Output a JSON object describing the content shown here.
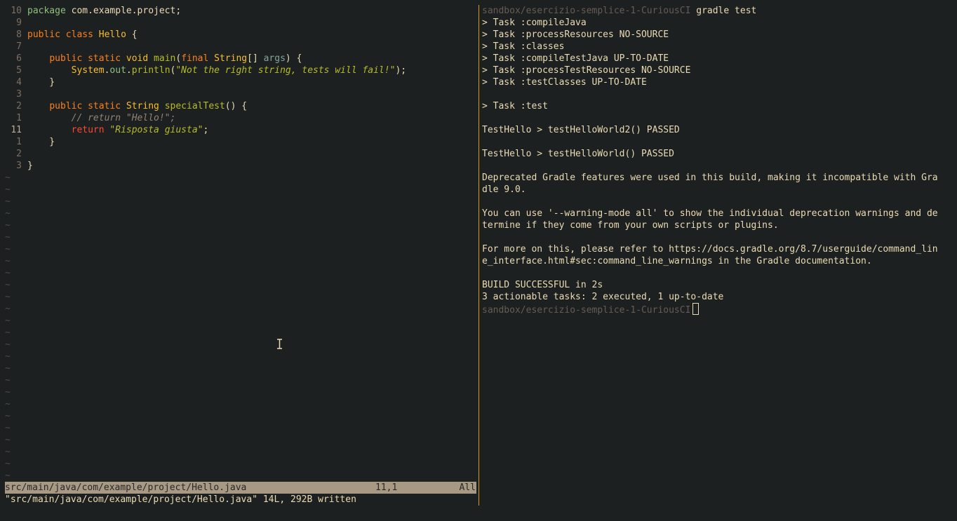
{
  "editor": {
    "lines": [
      {
        "num": "10",
        "tokens": [
          {
            "c": "pkg",
            "t": "package"
          },
          {
            "c": "plain",
            "t": " com.example.project;"
          }
        ]
      },
      {
        "num": "9",
        "tokens": []
      },
      {
        "num": "8",
        "tokens": [
          {
            "c": "kw",
            "t": "public"
          },
          {
            "c": "plain",
            "t": " "
          },
          {
            "c": "kw",
            "t": "class"
          },
          {
            "c": "plain",
            "t": " "
          },
          {
            "c": "cls",
            "t": "Hello"
          },
          {
            "c": "plain",
            "t": " {"
          }
        ]
      },
      {
        "num": "7",
        "tokens": []
      },
      {
        "num": "6",
        "tokens": [
          {
            "c": "plain",
            "t": "    "
          },
          {
            "c": "kw",
            "t": "public"
          },
          {
            "c": "plain",
            "t": " "
          },
          {
            "c": "kw",
            "t": "static"
          },
          {
            "c": "plain",
            "t": " "
          },
          {
            "c": "type",
            "t": "void"
          },
          {
            "c": "plain",
            "t": " "
          },
          {
            "c": "fn",
            "t": "main"
          },
          {
            "c": "plain",
            "t": "("
          },
          {
            "c": "kw",
            "t": "final"
          },
          {
            "c": "plain",
            "t": " "
          },
          {
            "c": "type",
            "t": "String"
          },
          {
            "c": "plain",
            "t": "[] "
          },
          {
            "c": "param",
            "t": "args"
          },
          {
            "c": "plain",
            "t": ") {"
          }
        ]
      },
      {
        "num": "5",
        "tokens": [
          {
            "c": "plain",
            "t": "        "
          },
          {
            "c": "type",
            "t": "System"
          },
          {
            "c": "plain",
            "t": "."
          },
          {
            "c": "member",
            "t": "out"
          },
          {
            "c": "plain",
            "t": "."
          },
          {
            "c": "fn",
            "t": "println"
          },
          {
            "c": "plain",
            "t": "("
          },
          {
            "c": "str",
            "t": "\"Not the right string, tests will fail!\""
          },
          {
            "c": "plain",
            "t": ");"
          }
        ]
      },
      {
        "num": "4",
        "tokens": [
          {
            "c": "plain",
            "t": "    }"
          }
        ]
      },
      {
        "num": "3",
        "tokens": []
      },
      {
        "num": "2",
        "tokens": [
          {
            "c": "plain",
            "t": "    "
          },
          {
            "c": "kw",
            "t": "public"
          },
          {
            "c": "plain",
            "t": " "
          },
          {
            "c": "kw",
            "t": "static"
          },
          {
            "c": "plain",
            "t": " "
          },
          {
            "c": "type",
            "t": "String"
          },
          {
            "c": "plain",
            "t": " "
          },
          {
            "c": "fn",
            "t": "specialTest"
          },
          {
            "c": "plain",
            "t": "() {"
          }
        ]
      },
      {
        "num": "1",
        "tokens": [
          {
            "c": "plain",
            "t": "        "
          },
          {
            "c": "cmt",
            "t": "// return \"Hello!\";"
          }
        ]
      },
      {
        "num": "11",
        "current": true,
        "tokens": [
          {
            "c": "plain",
            "t": "        "
          },
          {
            "c": "kw-red",
            "t": "return"
          },
          {
            "c": "plain",
            "t": " "
          },
          {
            "c": "str",
            "t": "\"Risposta giusta\""
          },
          {
            "c": "plain",
            "t": ";"
          }
        ]
      },
      {
        "num": "1",
        "tokens": [
          {
            "c": "plain",
            "t": "    }"
          }
        ]
      },
      {
        "num": "2",
        "tokens": []
      },
      {
        "num": "3",
        "tokens": [
          {
            "c": "plain",
            "t": "}"
          }
        ]
      }
    ],
    "tilde_count": 26,
    "tilde_char": "~"
  },
  "statusline": {
    "filename": "src/main/java/com/example/project/Hello.java",
    "position": "11,1",
    "scroll": "All"
  },
  "cmdline": {
    "message": "\"src/main/java/com/example/project/Hello.java\" 14L, 292B written"
  },
  "terminal": {
    "prompt_path": "sandbox/esercizio-semplice-1-CuriousCI",
    "command": "gradle test",
    "output": [
      "> Task :compileJava",
      "> Task :processResources NO-SOURCE",
      "> Task :classes",
      "> Task :compileTestJava UP-TO-DATE",
      "> Task :processTestResources NO-SOURCE",
      "> Task :testClasses UP-TO-DATE",
      "",
      "> Task :test",
      "",
      "TestHello > testHelloWorld2() PASSED",
      "",
      "TestHello > testHelloWorld() PASSED",
      "",
      "Deprecated Gradle features were used in this build, making it incompatible with Gra",
      "dle 9.0.",
      "",
      "You can use '--warning-mode all' to show the individual deprecation warnings and de",
      "termine if they come from your own scripts or plugins.",
      "",
      "For more on this, please refer to https://docs.gradle.org/8.7/userguide/command_lin",
      "e_interface.html#sec:command_line_warnings in the Gradle documentation.",
      "",
      "BUILD SUCCESSFUL in 2s",
      "3 actionable tasks: 2 executed, 1 up-to-date"
    ],
    "final_prompt_path": "sandbox/esercizio-semplice-1-CuriousCI"
  }
}
